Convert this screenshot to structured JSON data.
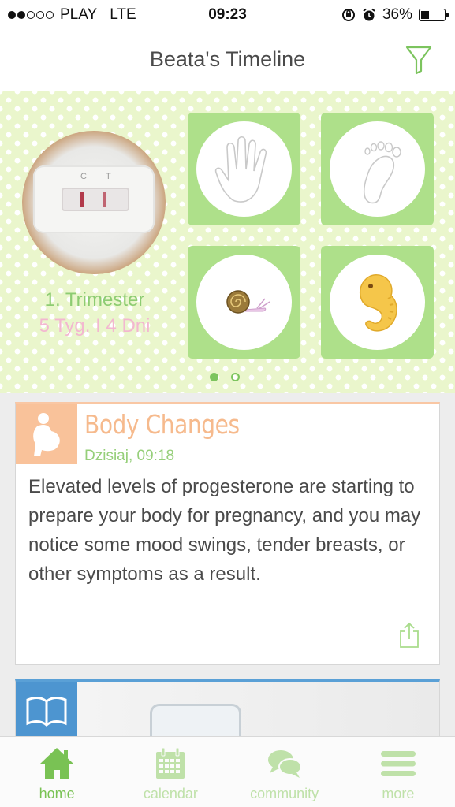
{
  "status_bar": {
    "carrier": "PLAY",
    "network": "LTE",
    "time": "09:23",
    "battery": "36%",
    "battery_level": 0.36,
    "signal_bars_filled": 2,
    "signal_bars_total": 5
  },
  "header": {
    "title": "Beata's Timeline",
    "filter_icon": "filter-icon"
  },
  "hero": {
    "trimester": "1. Trimester",
    "duration": "5 Tyg. I 4 Dni",
    "test_labels": [
      "C",
      "T"
    ],
    "tiles": [
      {
        "name": "hand-print",
        "icon": "hand-icon"
      },
      {
        "name": "foot-print",
        "icon": "foot-icon"
      },
      {
        "name": "snail",
        "icon": "snail-icon"
      },
      {
        "name": "embryo",
        "icon": "embryo-icon"
      }
    ],
    "page_count": 2,
    "active_page": 1
  },
  "cards": [
    {
      "icon": "pregnant-woman-icon",
      "title": "Body Changes",
      "date": "Dzisiaj, 09:18",
      "body": "Elevated levels of progesterone are starting to prepare your body for pregnancy, and you may notice some mood swings, tender breasts, or other symptoms as a result.",
      "share_icon": "share-icon"
    },
    {
      "icon": "book-icon"
    }
  ],
  "tabs": [
    {
      "label": "home",
      "icon": "home-icon",
      "active": true
    },
    {
      "label": "calendar",
      "icon": "calendar-icon",
      "active": false
    },
    {
      "label": "community",
      "icon": "chat-bubbles-icon",
      "active": false
    },
    {
      "label": "more",
      "icon": "menu-icon",
      "active": false
    }
  ],
  "colors": {
    "accent_green": "#79c254",
    "light_green": "#aee08a",
    "hero_background": "#eaf6cc",
    "peach": "#f9c29a",
    "pink": "#f3b7d0",
    "blue": "#4d95d0"
  }
}
